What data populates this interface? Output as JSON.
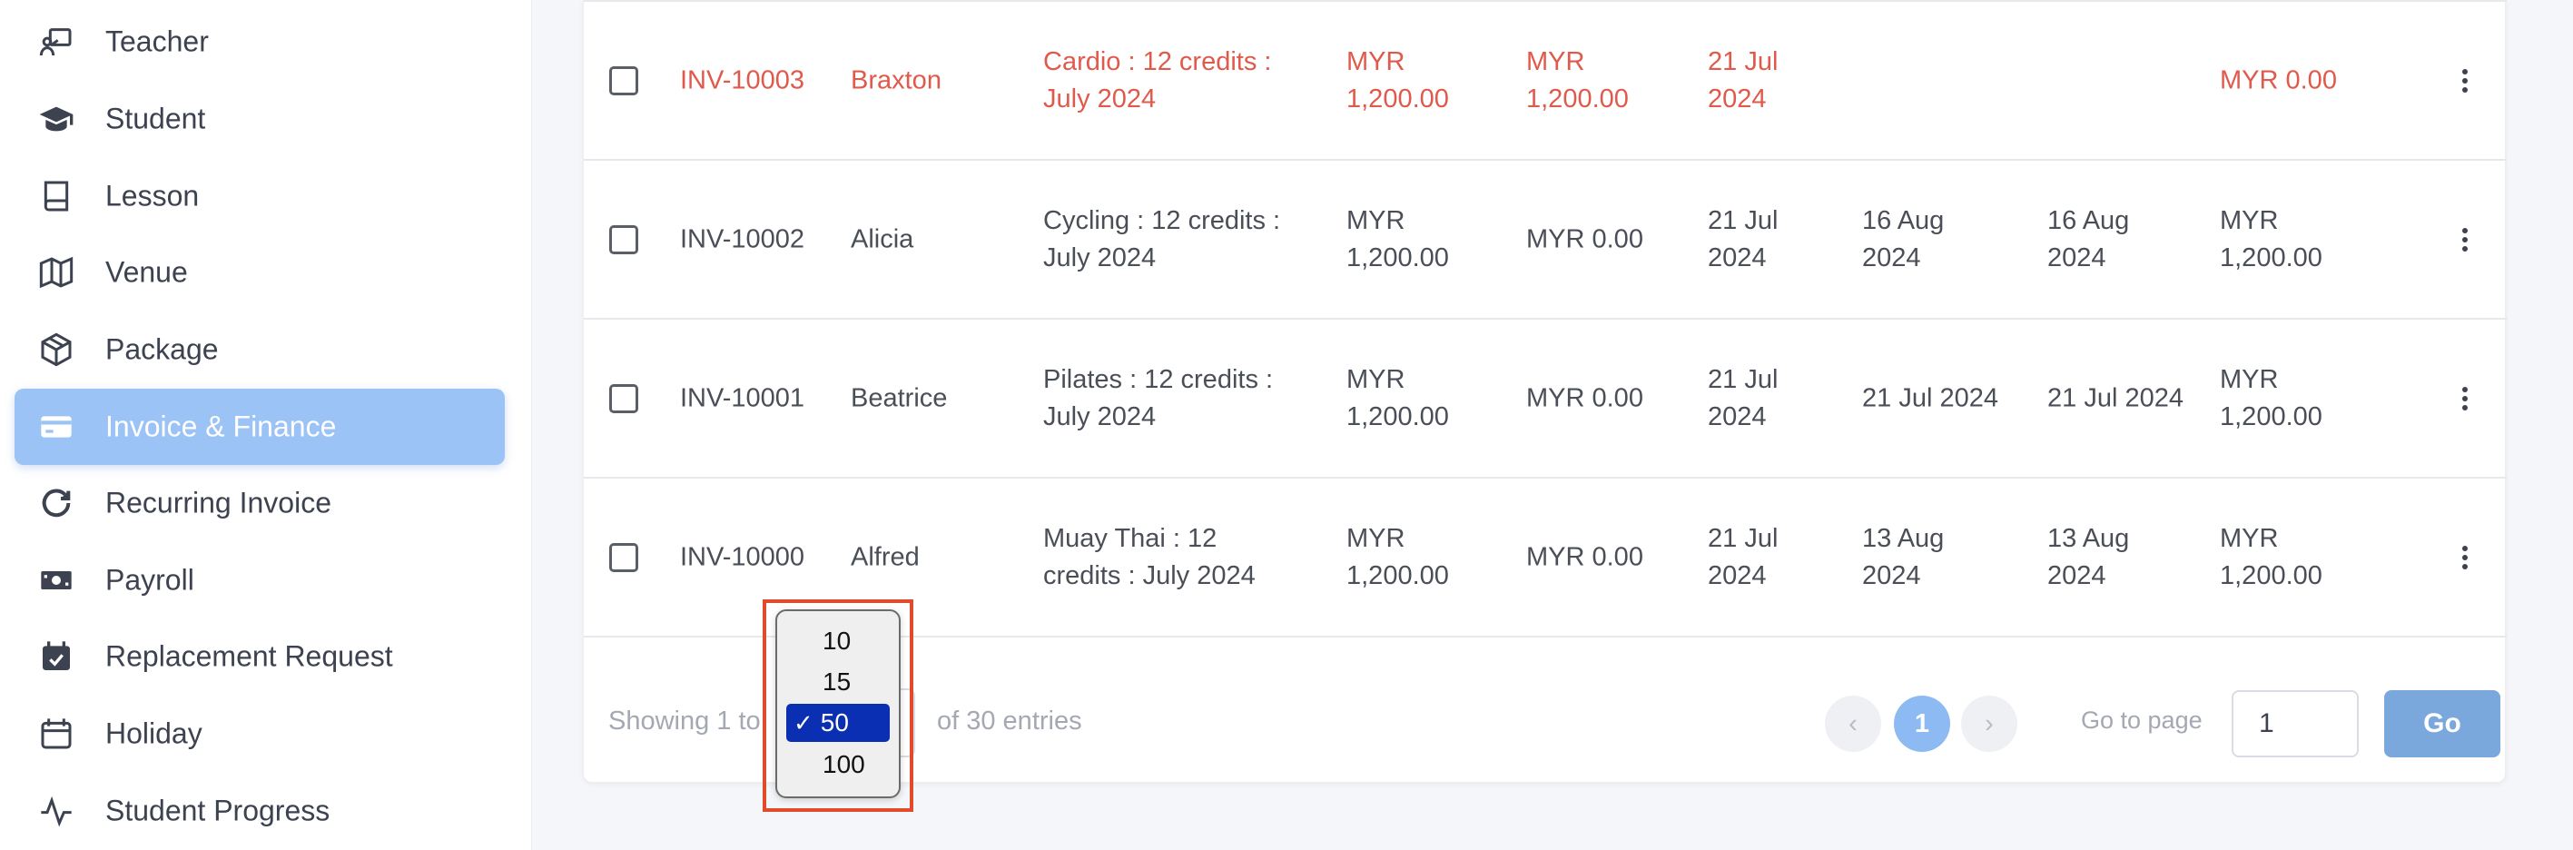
{
  "sidebar": {
    "items": [
      {
        "label": "Teacher",
        "icon": "teacher-icon"
      },
      {
        "label": "Student",
        "icon": "graduation-cap-icon"
      },
      {
        "label": "Lesson",
        "icon": "book-icon"
      },
      {
        "label": "Venue",
        "icon": "map-icon"
      },
      {
        "label": "Package",
        "icon": "package-icon"
      },
      {
        "label": "Invoice & Finance",
        "icon": "credit-card-icon",
        "active": true
      },
      {
        "label": "Recurring Invoice",
        "icon": "refresh-icon"
      },
      {
        "label": "Payroll",
        "icon": "money-icon"
      },
      {
        "label": "Replacement Request",
        "icon": "calendar-check-icon"
      },
      {
        "label": "Holiday",
        "icon": "calendar-icon"
      },
      {
        "label": "Student Progress",
        "icon": "activity-icon"
      }
    ]
  },
  "table": {
    "rows": [
      {
        "invoice": "INV-10003",
        "name": "Braxton",
        "package": "Cardio : 12 credits : July 2024",
        "amount": "MYR 1,200.00",
        "balance": "MYR 1,200.00",
        "issue_date": "21 Jul 2024",
        "due_date": "",
        "paid_date": "",
        "paid": "MYR 0.00",
        "overdue": true
      },
      {
        "invoice": "INV-10002",
        "name": "Alicia",
        "package": "Cycling : 12 credits : July 2024",
        "amount": "MYR 1,200.00",
        "balance": "MYR 0.00",
        "issue_date": "21 Jul 2024",
        "due_date": "16 Aug 2024",
        "paid_date": "16 Aug 2024",
        "paid": "MYR 1,200.00",
        "overdue": false
      },
      {
        "invoice": "INV-10001",
        "name": "Beatrice",
        "package": "Pilates : 12 credits : July 2024",
        "amount": "MYR 1,200.00",
        "balance": "MYR 0.00",
        "issue_date": "21 Jul 2024",
        "due_date": "21 Jul 2024",
        "paid_date": "21 Jul 2024",
        "paid": "MYR 1,200.00",
        "overdue": false
      },
      {
        "invoice": "INV-10000",
        "name": "Alfred",
        "package": "Muay Thai : 12 credits : July 2024",
        "amount": "MYR 1,200.00",
        "balance": "MYR 0.00",
        "issue_date": "21 Jul 2024",
        "due_date": "13 Aug 2024",
        "paid_date": "13 Aug 2024",
        "paid": "MYR 1,200.00",
        "overdue": false
      }
    ],
    "row_lines": [
      {
        "package": [
          "Cardio : 12 credits :",
          "July 2024"
        ],
        "amount": [
          "MYR",
          "1,200.00"
        ],
        "balance": [
          "MYR",
          "1,200.00"
        ],
        "issue": [
          "21 Jul",
          "2024"
        ],
        "due": [],
        "paid_date": [],
        "paid": [
          "MYR 0.00"
        ]
      },
      {
        "package": [
          "Cycling : 12 credits :",
          "July 2024"
        ],
        "amount": [
          "MYR",
          "1,200.00"
        ],
        "balance": [
          "MYR 0.00"
        ],
        "issue": [
          "21 Jul",
          "2024"
        ],
        "due": [
          "16 Aug",
          "2024"
        ],
        "paid_date": [
          "16 Aug",
          "2024"
        ],
        "paid": [
          "MYR",
          "1,200.00"
        ]
      },
      {
        "package": [
          "Pilates : 12 credits :",
          "July 2024"
        ],
        "amount": [
          "MYR",
          "1,200.00"
        ],
        "balance": [
          "MYR 0.00"
        ],
        "issue": [
          "21 Jul",
          "2024"
        ],
        "due": [
          "21 Jul 2024"
        ],
        "paid_date": [
          "21 Jul 2024"
        ],
        "paid": [
          "MYR",
          "1,200.00"
        ]
      },
      {
        "package": [
          "Muay Thai : 12",
          "credits : July 2024"
        ],
        "amount": [
          "MYR",
          "1,200.00"
        ],
        "balance": [
          "MYR 0.00"
        ],
        "issue": [
          "21 Jul",
          "2024"
        ],
        "due": [
          "13 Aug",
          "2024"
        ],
        "paid_date": [
          "13 Aug",
          "2024"
        ],
        "paid": [
          "MYR",
          "1,200.00"
        ]
      }
    ]
  },
  "footer": {
    "showing_prefix": "Showing 1 to",
    "showing_suffix": "of 30 entries",
    "prev_symbol": "‹",
    "current_page": "1",
    "next_symbol": "›",
    "goto_label": "Go to page",
    "goto_value": "1",
    "go_button": "Go"
  },
  "entries_dropdown": {
    "options": [
      "10",
      "15",
      "50",
      "100"
    ],
    "selected": "50",
    "check_mark": "✓"
  },
  "colors": {
    "accent": "#9cc3f5",
    "overdue": "#e05a4c",
    "highlight": "#e24a2c",
    "selected_option": "#0a2fb3"
  }
}
